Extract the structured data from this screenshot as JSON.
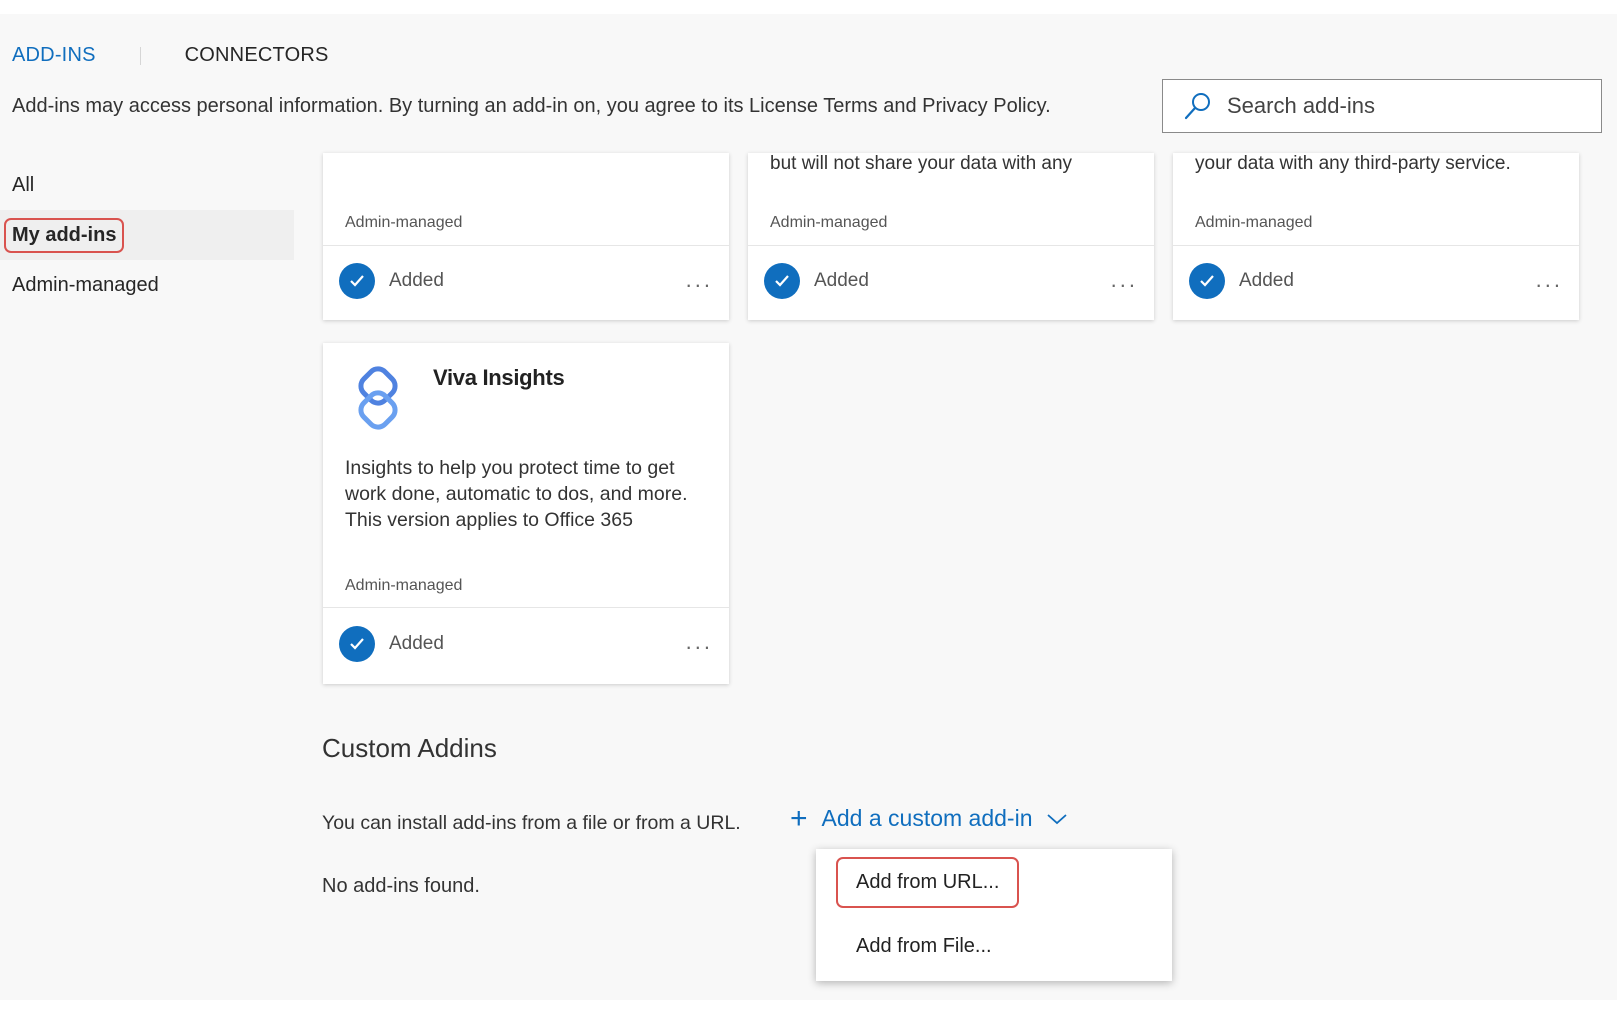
{
  "tabs": [
    {
      "label": "ADD-INS",
      "active": true
    },
    {
      "label": "CONNECTORS",
      "active": false
    }
  ],
  "disclaimer": "Add-ins may access personal information. By turning an add-in on, you agree to its License Terms and Privacy Policy.",
  "search": {
    "placeholder": "Search add-ins"
  },
  "nav": [
    {
      "label": "All"
    },
    {
      "label": "My add-ins",
      "selected": true
    },
    {
      "label": "Admin-managed"
    }
  ],
  "cards_top": [
    {
      "desc_tail": "",
      "managed": "Admin-managed",
      "status": "Added",
      "more": "..."
    },
    {
      "desc_tail": "but will not share your data with any",
      "managed": "Admin-managed",
      "status": "Added",
      "more": "..."
    },
    {
      "desc_tail": "your data with any third-party service.",
      "managed": "Admin-managed",
      "status": "Added",
      "more": "..."
    }
  ],
  "viva_card": {
    "title": "Viva Insights",
    "description": "Insights to help you protect time to get work done, automatic to dos, and more. This version applies to Office 365",
    "managed": "Admin-managed",
    "status": "Added",
    "more": "..."
  },
  "custom": {
    "title": "Custom Addins",
    "install_text": "You can install add-ins from a file or from a URL.",
    "add_label": "Add a custom add-in",
    "empty_text": "No add-ins found."
  },
  "dropdown": {
    "options": [
      "Add from URL...",
      "Add from File..."
    ]
  },
  "colors": {
    "accent": "#106ebe",
    "highlight": "#d9534f"
  }
}
